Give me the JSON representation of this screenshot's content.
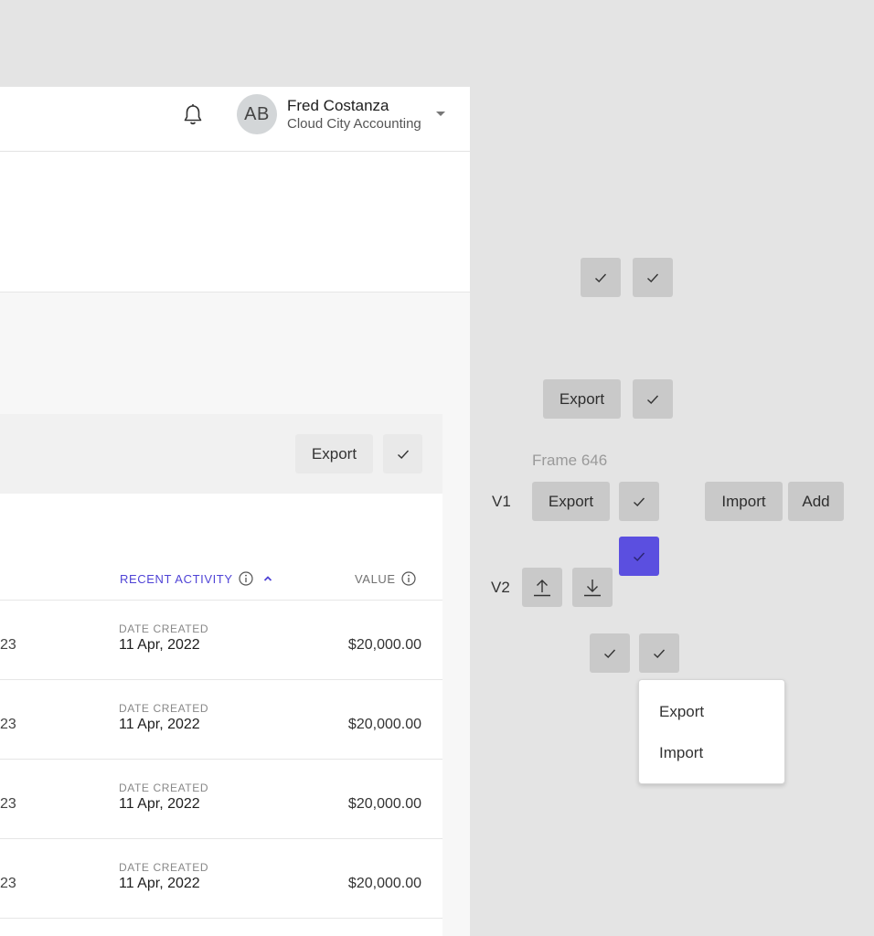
{
  "header": {
    "avatar_initials": "AB",
    "user_name": "Fred Costanza",
    "org_name": "Cloud City Accounting"
  },
  "card": {
    "export_label": "Export",
    "columns": {
      "recent_activity": "RECENT ACTIVITY",
      "value": "VALUE"
    },
    "rows": [
      {
        "left_text": "23",
        "label": "DATE CREATED",
        "date": "11 Apr, 2022",
        "value": "$20,000.00"
      },
      {
        "left_text": "23",
        "label": "DATE CREATED",
        "date": "11 Apr, 2022",
        "value": "$20,000.00"
      },
      {
        "left_text": "23",
        "label": "DATE CREATED",
        "date": "11 Apr, 2022",
        "value": "$20,000.00"
      },
      {
        "left_text": "23",
        "label": "DATE CREATED",
        "date": "11 Apr, 2022",
        "value": "$20,000.00"
      }
    ]
  },
  "variants": {
    "export_label": "Export",
    "frame_label": "Frame 646",
    "v1_label": "V1",
    "v1_export": "Export",
    "v1_import": "Import",
    "v1_add": "Add",
    "v2_label": "V2",
    "menu": [
      "Export",
      "Import"
    ]
  },
  "colors": {
    "accent": "#5b4fe0",
    "button_grey": "#c9c9c9",
    "canvas": "#e4e4e4"
  }
}
